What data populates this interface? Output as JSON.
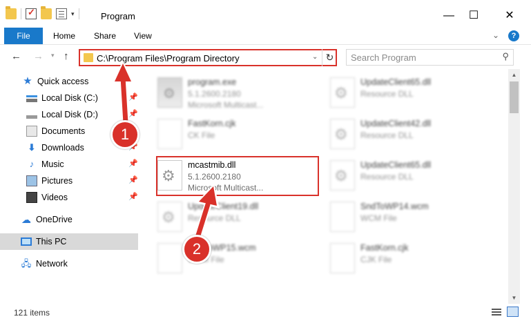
{
  "window": {
    "title": "Program",
    "controls": {
      "minimize": "—",
      "maximize": "☐",
      "close": "✕"
    }
  },
  "ribbon": {
    "tabs": {
      "file": "File",
      "home": "Home",
      "share": "Share",
      "view": "View"
    },
    "help": "?"
  },
  "nav": {
    "address": "C:\\Program Files\\Program Directory",
    "search_placeholder": "Search Program"
  },
  "sidebar": {
    "items": [
      {
        "label": "Quick access",
        "icon": "star-icon"
      },
      {
        "label": "Local Disk (C:)",
        "icon": "drive-icon",
        "pinned": true
      },
      {
        "label": "Local Disk (D:)",
        "icon": "drive-icon",
        "pinned": true
      },
      {
        "label": "Documents",
        "icon": "documents-icon",
        "pinned": true
      },
      {
        "label": "Downloads",
        "icon": "download-icon",
        "pinned": true
      },
      {
        "label": "Music",
        "icon": "music-icon",
        "pinned": true
      },
      {
        "label": "Pictures",
        "icon": "pictures-icon",
        "pinned": true
      },
      {
        "label": "Videos",
        "icon": "videos-icon",
        "pinned": true
      },
      {
        "label": "OneDrive",
        "icon": "cloud-icon"
      },
      {
        "label": "This PC",
        "icon": "computer-icon",
        "selected": true
      },
      {
        "label": "Network",
        "icon": "network-icon"
      }
    ]
  },
  "files": [
    {
      "name": "program.exe",
      "line2": "5.1.2600.2180",
      "line3": "Microsoft Multicast...",
      "icon": "exe-icon"
    },
    {
      "name": "UpdateClient65.dll",
      "line2": "Resource DLL",
      "line3": "",
      "icon": "dll-icon"
    },
    {
      "name": "FastKorn.cjk",
      "line2": "CK File",
      "line3": "",
      "icon": "file-icon"
    },
    {
      "name": "UpdateClient42.dll",
      "line2": "Resource DLL",
      "line3": "",
      "icon": "dll-icon"
    },
    {
      "name": "mcastmib.dll",
      "line2": "5.1.2600.2180",
      "line3": "Microsoft Multicast...",
      "icon": "dll-icon"
    },
    {
      "name": "UpdateClient65.dll",
      "line2": "Resource DLL",
      "line3": "",
      "icon": "dll-icon"
    },
    {
      "name": "UpdateClient19.dll",
      "line2": "Resource DLL",
      "line3": "",
      "icon": "dll-icon"
    },
    {
      "name": "SndToWP14.wcm",
      "line2": "WCM File",
      "line3": "",
      "icon": "file-icon"
    },
    {
      "name": "SndToWP15.wcm",
      "line2": "WCM File",
      "line3": "",
      "icon": "file-icon"
    },
    {
      "name": "FastKorn.cjk",
      "line2": "CJK File",
      "line3": "",
      "icon": "file-icon"
    }
  ],
  "status": {
    "item_count": "121 items"
  },
  "callouts": {
    "step1": "1",
    "step2": "2"
  },
  "colors": {
    "accent": "#1979ca",
    "highlight": "#d9312a"
  }
}
